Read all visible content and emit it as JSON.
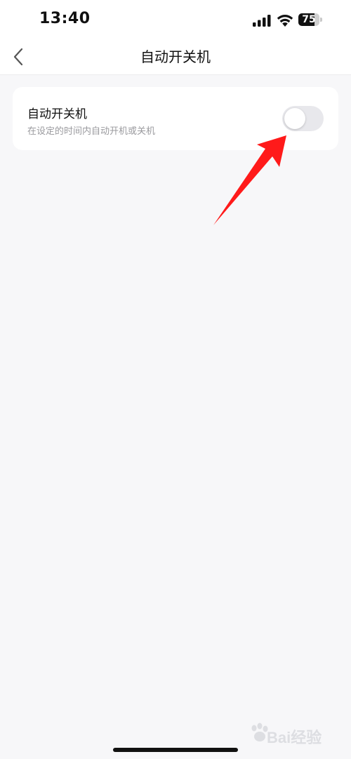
{
  "status_bar": {
    "time": "13:40",
    "battery_level": "75",
    "battery_fraction": 0.75
  },
  "nav": {
    "title": "自动开关机",
    "back_icon": "chevron-left-icon"
  },
  "setting": {
    "title": "自动开关机",
    "description": "在设定的时间内自动开机或关机",
    "toggle_on": false
  },
  "watermark": {
    "text": "Bai经验"
  },
  "colors": {
    "background": "#f7f7f9",
    "card": "#ffffff",
    "toggle_off": "#e8e8ec",
    "annotation_arrow": "#ff1a1a",
    "secondary_text": "#9a9a9e"
  }
}
